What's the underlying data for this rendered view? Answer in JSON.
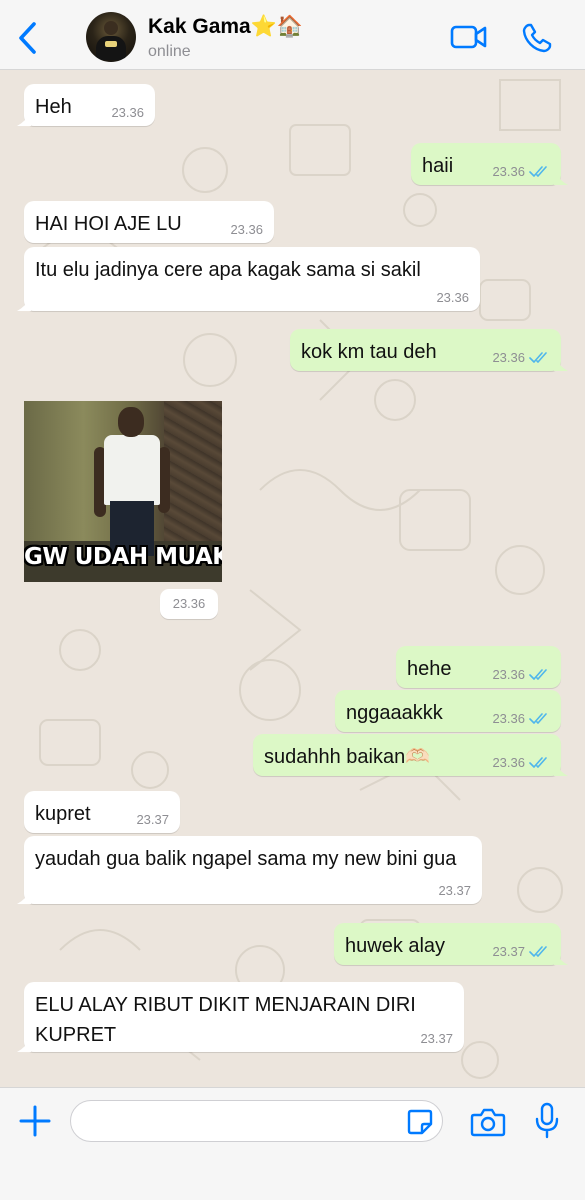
{
  "header": {
    "contact_name": "Kak Gama⭐🏠",
    "status": "online"
  },
  "messages": [
    {
      "id": 1,
      "direction": "in",
      "text": "Heh",
      "time": "23.36"
    },
    {
      "id": 2,
      "direction": "out",
      "text": "haii",
      "time": "23.36",
      "read": true
    },
    {
      "id": 3,
      "direction": "in",
      "text": "HAI HOI AJE LU",
      "time": "23.36"
    },
    {
      "id": 4,
      "direction": "in",
      "text": "Itu elu jadinya cere apa kagak sama si sakil",
      "time": "23.36"
    },
    {
      "id": 5,
      "direction": "out",
      "text": "kok km tau deh",
      "time": "23.36",
      "read": true
    },
    {
      "id": 6,
      "direction": "in",
      "type": "sticker",
      "caption": "GW UDAH MUAK",
      "time": "23.36"
    },
    {
      "id": 7,
      "direction": "out",
      "text": "hehe",
      "time": "23.36",
      "read": true
    },
    {
      "id": 8,
      "direction": "out",
      "text": "nggaaakkk",
      "time": "23.36",
      "read": true
    },
    {
      "id": 9,
      "direction": "out",
      "text": "sudahhh baikan🫶🏻",
      "time": "23.36",
      "read": true
    },
    {
      "id": 10,
      "direction": "in",
      "text": "kupret",
      "time": "23.37"
    },
    {
      "id": 11,
      "direction": "in",
      "text": "yaudah gua balik ngapel sama my new bini gua",
      "time": "23.37"
    },
    {
      "id": 12,
      "direction": "out",
      "text": "huwek alay",
      "time": "23.37",
      "read": true
    },
    {
      "id": 13,
      "direction": "in",
      "text": "ELU ALAY RIBUT DIKIT MENJARAIN DIRI KUPRET",
      "time": "23.37"
    }
  ],
  "composer": {
    "placeholder": ""
  },
  "colors": {
    "accent": "#007aff",
    "incoming_bubble": "#ffffff",
    "outgoing_bubble": "#dcf8c6",
    "chat_background": "#ece5dd",
    "read_tick": "#4fb6ec"
  },
  "icons": [
    "back-chevron-icon",
    "video-call-icon",
    "phone-icon",
    "plus-icon",
    "sticker-icon",
    "camera-icon",
    "microphone-icon",
    "double-check-icon"
  ]
}
